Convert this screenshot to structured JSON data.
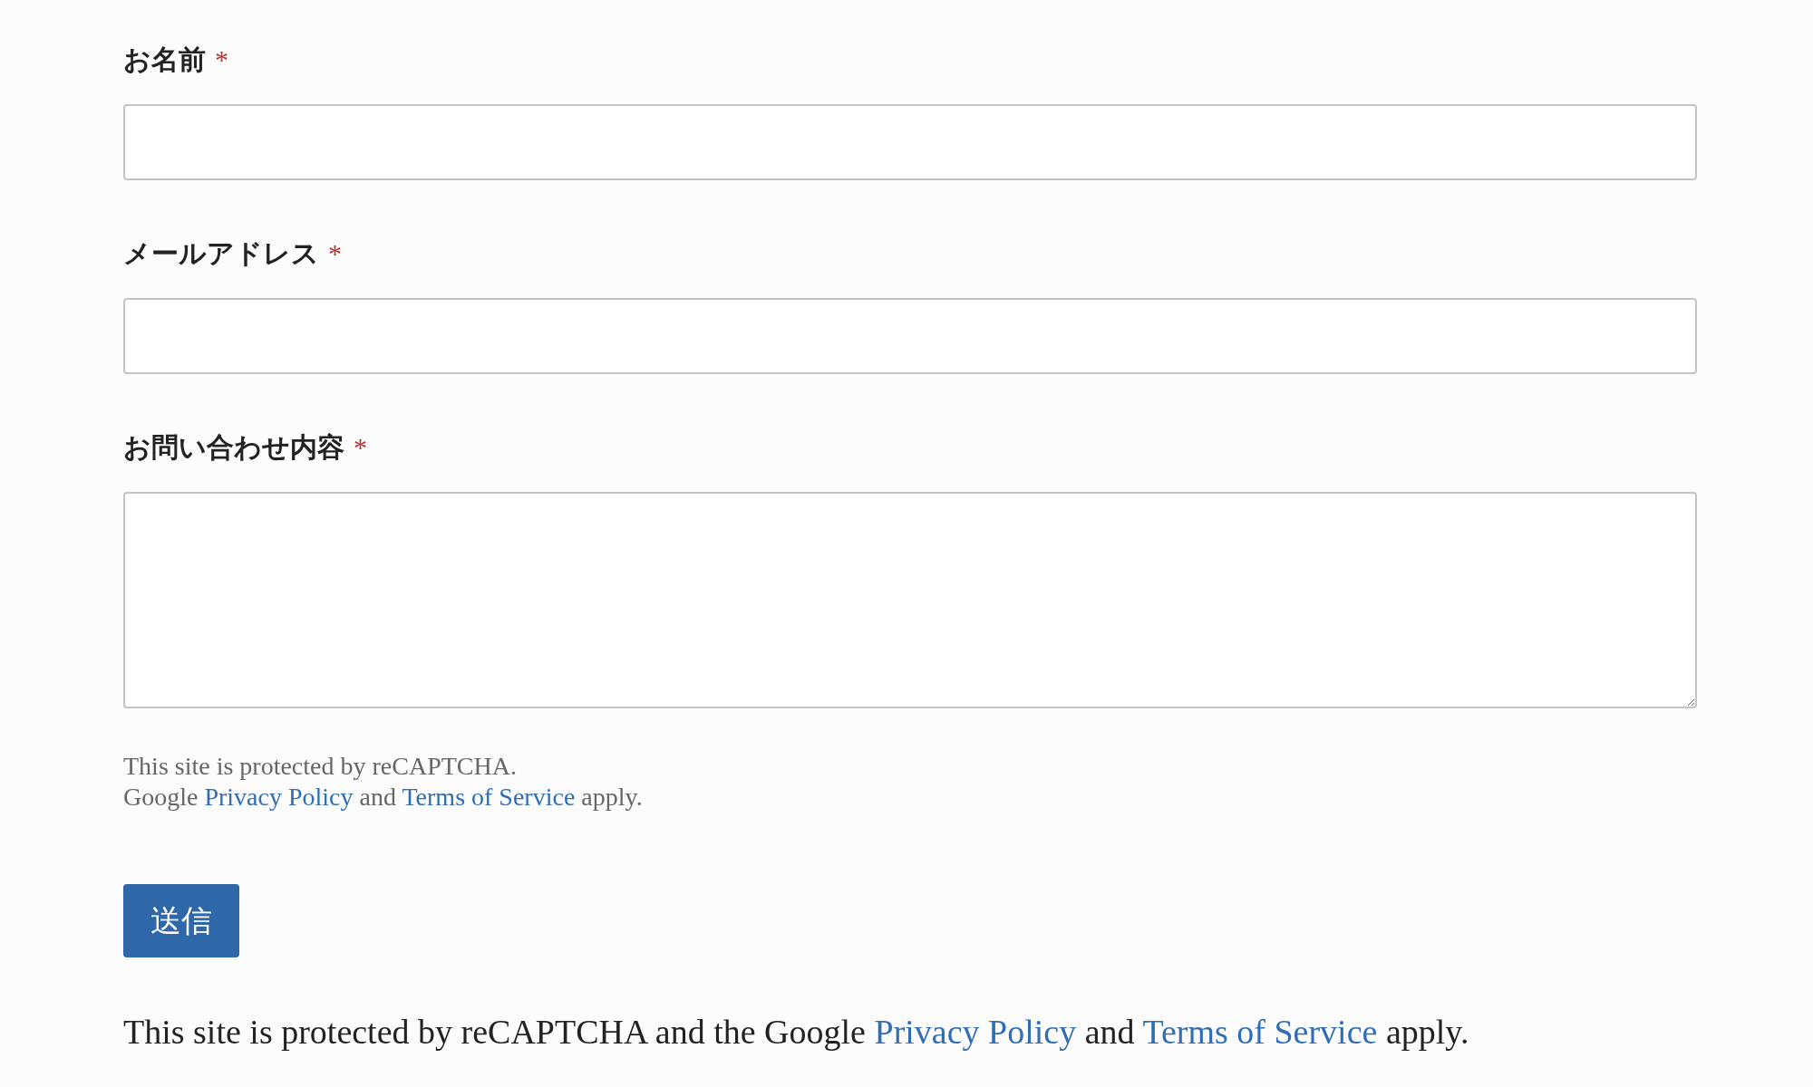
{
  "fields": [
    {
      "label": "お名前",
      "marker": "*",
      "kind": "input"
    },
    {
      "label": "メールアドレス",
      "marker": "*",
      "kind": "input"
    },
    {
      "label": "お問い合わせ内容",
      "marker": "*",
      "kind": "textarea"
    }
  ],
  "note": {
    "lines": [
      [
        {
          "text": "This site is protected by reCAPTCHA.",
          "kind": "text"
        }
      ],
      [
        {
          "text": "Google ",
          "kind": "text"
        },
        {
          "text": "Privacy Policy",
          "kind": "link"
        },
        {
          "text": " and ",
          "kind": "text"
        },
        {
          "text": "Terms of Service",
          "kind": "link"
        },
        {
          "text": " apply.",
          "kind": "text"
        }
      ]
    ]
  },
  "submit": {
    "label": "送信"
  },
  "footer": [
    {
      "text": "This site is protected by reCAPTCHA and the Google ",
      "kind": "text"
    },
    {
      "text": "Privacy Policy",
      "kind": "link"
    },
    {
      "text": " and ",
      "kind": "text"
    },
    {
      "text": "Terms of Service",
      "kind": "link"
    },
    {
      "text": " apply.",
      "kind": "text"
    }
  ]
}
